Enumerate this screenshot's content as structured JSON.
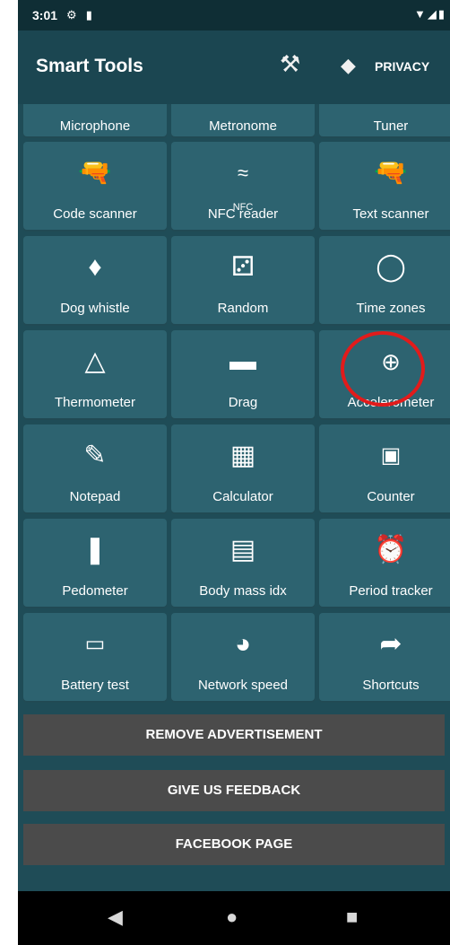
{
  "status_bar": {
    "time": "3:01",
    "icons": [
      "gear-icon",
      "sd-card-icon"
    ],
    "right_icons": [
      "wifi-icon",
      "signal-icon",
      "battery-icon"
    ]
  },
  "app_bar": {
    "title": "Smart Tools",
    "tool_icon": "wrench-icon",
    "navigation_icon": "direction-icon",
    "privacy_label": "PRIVACY"
  },
  "grid": {
    "partial_row": [
      {
        "label": "Microphone"
      },
      {
        "label": "Metronome"
      },
      {
        "label": "Tuner"
      }
    ],
    "rows": [
      [
        {
          "label": "Code scanner",
          "icon": "barcode-scanner-icon"
        },
        {
          "label": "NFC reader",
          "icon": "nfc-icon"
        },
        {
          "label": "Text scanner",
          "icon": "text-scanner-icon"
        }
      ],
      [
        {
          "label": "Dog whistle",
          "icon": "whistle-icon"
        },
        {
          "label": "Random",
          "icon": "dice-icon"
        },
        {
          "label": "Time zones",
          "icon": "globe-icon"
        }
      ],
      [
        {
          "label": "Thermometer",
          "icon": "thermometer-icon"
        },
        {
          "label": "Drag",
          "icon": "car-icon"
        },
        {
          "label": "Accelerometer",
          "icon": "accelerometer-icon"
        }
      ],
      [
        {
          "label": "Notepad",
          "icon": "edit-icon"
        },
        {
          "label": "Calculator",
          "icon": "calculator-icon"
        },
        {
          "label": "Counter",
          "icon": "counter-icon"
        }
      ],
      [
        {
          "label": "Pedometer",
          "icon": "footsteps-icon"
        },
        {
          "label": "Body mass idx",
          "icon": "scale-icon"
        },
        {
          "label": "Period tracker",
          "icon": "alarm-clock-icon"
        }
      ],
      [
        {
          "label": "Battery test",
          "icon": "battery-icon"
        },
        {
          "label": "Network speed",
          "icon": "speedometer-icon"
        },
        {
          "label": "Shortcuts",
          "icon": "share-icon"
        }
      ]
    ]
  },
  "buttons": {
    "remove_ads": "REMOVE ADVERTISEMENT",
    "feedback": "GIVE US FEEDBACK",
    "facebook": "FACEBOOK PAGE"
  },
  "nav_bar": {
    "back_icon": "back-icon",
    "home_icon": "home-icon",
    "recents_icon": "recents-icon"
  },
  "colors": {
    "background": "#1f4c57",
    "tile": "#2d6370",
    "button": "#4b4b4b",
    "highlight": "#e21b1b"
  }
}
